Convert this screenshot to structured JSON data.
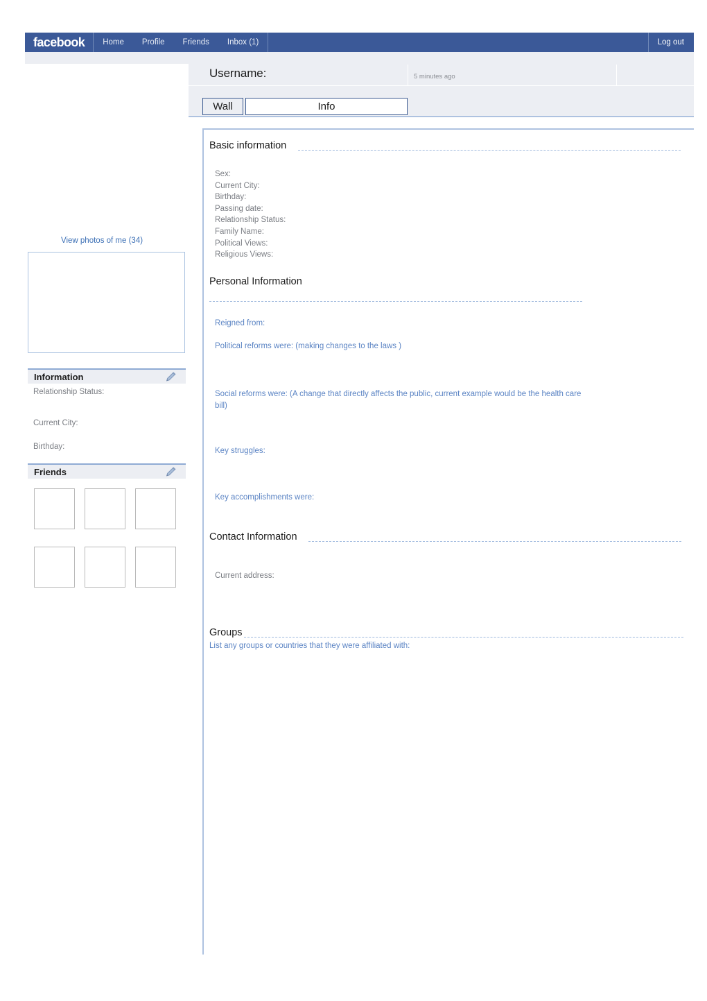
{
  "navbar": {
    "brand": "facebook",
    "links": [
      {
        "label": "Home",
        "name": "nav-home"
      },
      {
        "label": "Profile",
        "name": "nav-profile"
      },
      {
        "label": "Friends",
        "name": "nav-friends"
      },
      {
        "label": "Inbox (1)",
        "name": "nav-inbox"
      }
    ],
    "logout": "Log out",
    "brand_bg": "#3b5998"
  },
  "profile": {
    "username_label": "Username:",
    "time_ago": "5 minutes ago"
  },
  "tabs": [
    {
      "label": "Wall",
      "active": false
    },
    {
      "label": "Info",
      "active": true
    }
  ],
  "sidebar": {
    "view_photos": "View photos of me (34)",
    "information": {
      "title": "Information",
      "fields": [
        "Relationship Status:",
        "Current City:",
        "Birthday:"
      ],
      "edit_icon": "pencil-icon"
    },
    "friends": {
      "title": "Friends",
      "edit_icon": "pencil-icon",
      "thumbnail_count": 6
    }
  },
  "main": {
    "basic_information": {
      "heading": "Basic information",
      "fields": [
        "Sex:",
        "Current City:",
        "Birthday:",
        "Passing date:",
        "Relationship Status:",
        "Family Name:",
        "Political Views:",
        "Religious Views:"
      ]
    },
    "personal_information": {
      "heading": "Personal Information",
      "fields": [
        "Reigned from:",
        "Political reforms were: (making changes to the laws )",
        "Social reforms were: (A change that directly affects the public, current example would be the health care bill)",
        "Key struggles:",
        "Key accomplishments were:"
      ]
    },
    "contact_information": {
      "heading": "Contact Information",
      "fields": [
        "Current address:"
      ]
    },
    "groups": {
      "heading": "Groups",
      "prompt": "List  any groups or countries  that they were affiliated with:"
    }
  },
  "colors": {
    "facebook_blue": "#3b5998",
    "band_grey": "#eceef3",
    "link_blue": "#3b6fb5",
    "label_blue": "#5b84c4",
    "label_grey": "#7b7e84",
    "rule_blue": "#9db8dd"
  }
}
